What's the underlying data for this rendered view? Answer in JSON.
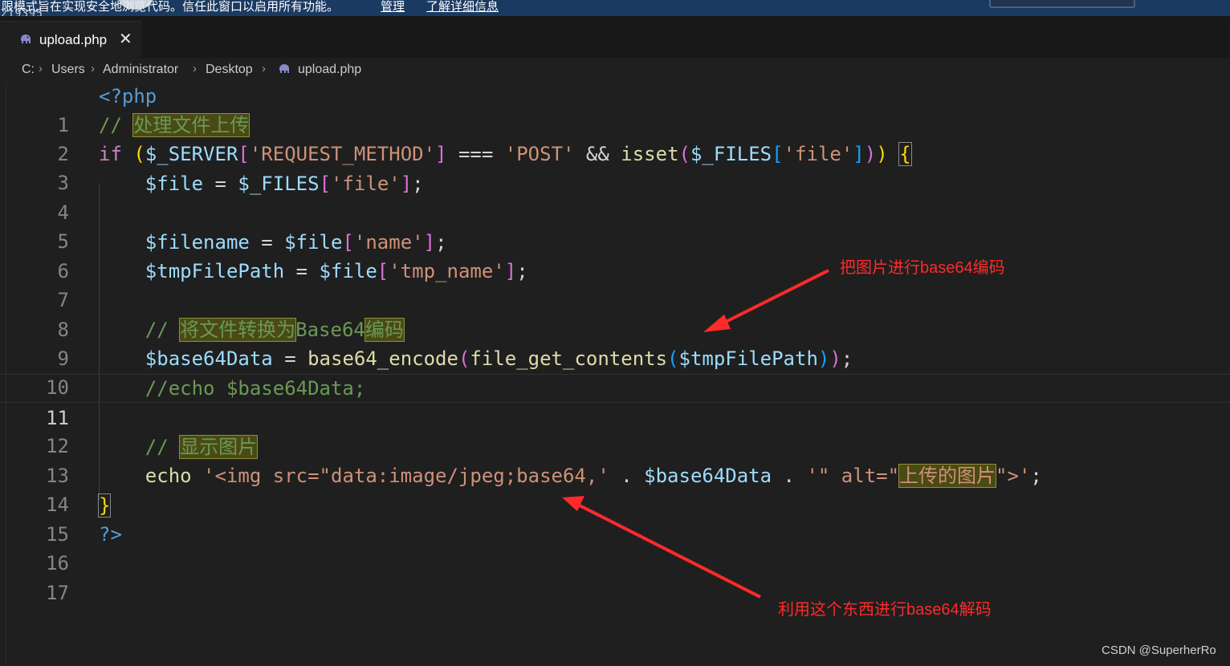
{
  "banner": {
    "message": "限模式旨在实现安全地浏览代码。信任此窗口以启用所有功能。",
    "manage_link": "管理",
    "learn_more_link": "了解详细信息",
    "partial_text": "5219395"
  },
  "tabs": [
    {
      "label": "upload.php",
      "close_glyph": "✕"
    }
  ],
  "breadcrumb": {
    "items": [
      "C:",
      "Users",
      "Administrator",
      "Desktop",
      "upload.php"
    ],
    "separator": "›"
  },
  "editor": {
    "active_line": 11,
    "line_numbers": [
      "1",
      "2",
      "3",
      "4",
      "5",
      "6",
      "7",
      "8",
      "9",
      "10",
      "11",
      "12",
      "13",
      "14",
      "15",
      "16",
      "17"
    ],
    "lines": [
      "<?php",
      "// 处理文件上传",
      "if ($_SERVER['REQUEST_METHOD'] === 'POST' && isset($_FILES['file'])) {",
      "    $file = $_FILES['file'];",
      "",
      "    $filename = $file['name'];",
      "    $tmpFilePath = $file['tmp_name'];",
      "",
      "    // 将文件转换为Base64编码",
      "    $base64Data = base64_encode(file_get_contents($tmpFilePath));",
      "    //echo $base64Data;",
      "",
      "    // 显示图片",
      "    echo '<img src=\"data:image/jpeg;base64,' . $base64Data . '\" alt=\"上传的图片\">';",
      "}",
      "?>",
      ""
    ]
  },
  "annotations": {
    "encode_note": "把图片进行base64编码",
    "decode_note": "利用这个东西进行base64解码",
    "color": "#ff2a2a"
  },
  "watermark": "CSDN @SuperherRo",
  "theme": {
    "editor_bg": "#1f1f1f",
    "banner_bg": "#1b3a61",
    "keyword": "#569cd6",
    "control": "#c586c0",
    "variable": "#9cdcfe",
    "string": "#ce9178",
    "comment": "#6a9955",
    "function": "#dcdcaa"
  },
  "icons": {
    "file_icon": "php-elephant-icon",
    "close_icon": "close-icon",
    "separator_icon": "chevron-right-icon"
  }
}
